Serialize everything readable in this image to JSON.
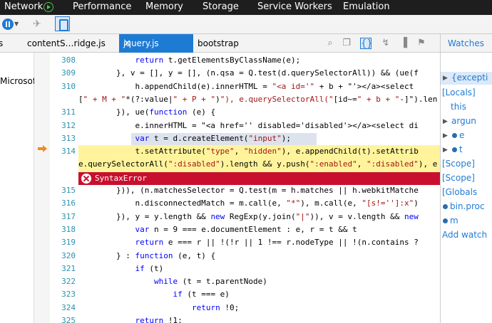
{
  "topbar": {
    "tabs": [
      "Network",
      "Performance",
      "Memory",
      "Storage",
      "Service Workers",
      "Emulation"
    ]
  },
  "tabs": {
    "files": [
      "s",
      "contentS…ridge.js",
      "jquery.js",
      "bootstrap"
    ],
    "active_close": "✕"
  },
  "left_panel": {
    "item": "MicrosoftM"
  },
  "code": {
    "line_numbers": [
      "308",
      "309",
      "310",
      "311",
      "312",
      "313",
      "314",
      "315",
      "316",
      "317",
      "318",
      "319",
      "320",
      "321",
      "322",
      "323",
      "324",
      "325"
    ],
    "lines": [
      "            return t.getElementsByClassName(e);",
      "        }, v = [], y = [], (n.qsa = Q.test(d.querySelectorAll)) && (ue(f",
      "            h.appendChild(e).innerHTML = \"<a id='\" + b + \"'></a><select",
      "[\" + M + \"*(?:value|\" + P + \")\"), e.querySelectorAll(\"[id~=\" + b + \"-]\").len",
      "        }), ue(function (e) {",
      "            e.innerHTML = \"<a href='' disabled='disabled'></a><select di",
      "            var t = d.createElement(\"input\");",
      "            t.setAttribute(\"type\", \"hidden\"), e.appendChild(t).setAttrib",
      "e.querySelectorAll(\":disabled\").length && y.push(\":enabled\", \":disabled\"), e",
      "        })), (n.matchesSelector = Q.test(m = h.matches || h.webkitMatche",
      "            n.disconnectedMatch = m.call(e, \"*\"), m.call(e, \"[s!='']:x\")",
      "        }), y = y.length && new RegExp(y.join(\"|\")), v = v.length && new",
      "            var n = 9 === e.documentElement : e, r = t && t",
      "            return e === r || !(!r || 1 !== r.nodeType || !(n.contains ?",
      "        } : function (e, t) {",
      "            if (t)",
      "                while (t = t.parentNode)",
      "                    if (t === e)",
      "                        return !0;",
      "            return !1;"
    ],
    "error": "SyntaxError"
  },
  "watches": {
    "title": "Watches",
    "items": [
      "{excepti",
      "[Locals]",
      "this",
      "argun",
      "e",
      "t",
      "[Scope]",
      "[Scope]",
      "[Globals",
      "bin.proc",
      "m",
      "Add watch"
    ]
  }
}
